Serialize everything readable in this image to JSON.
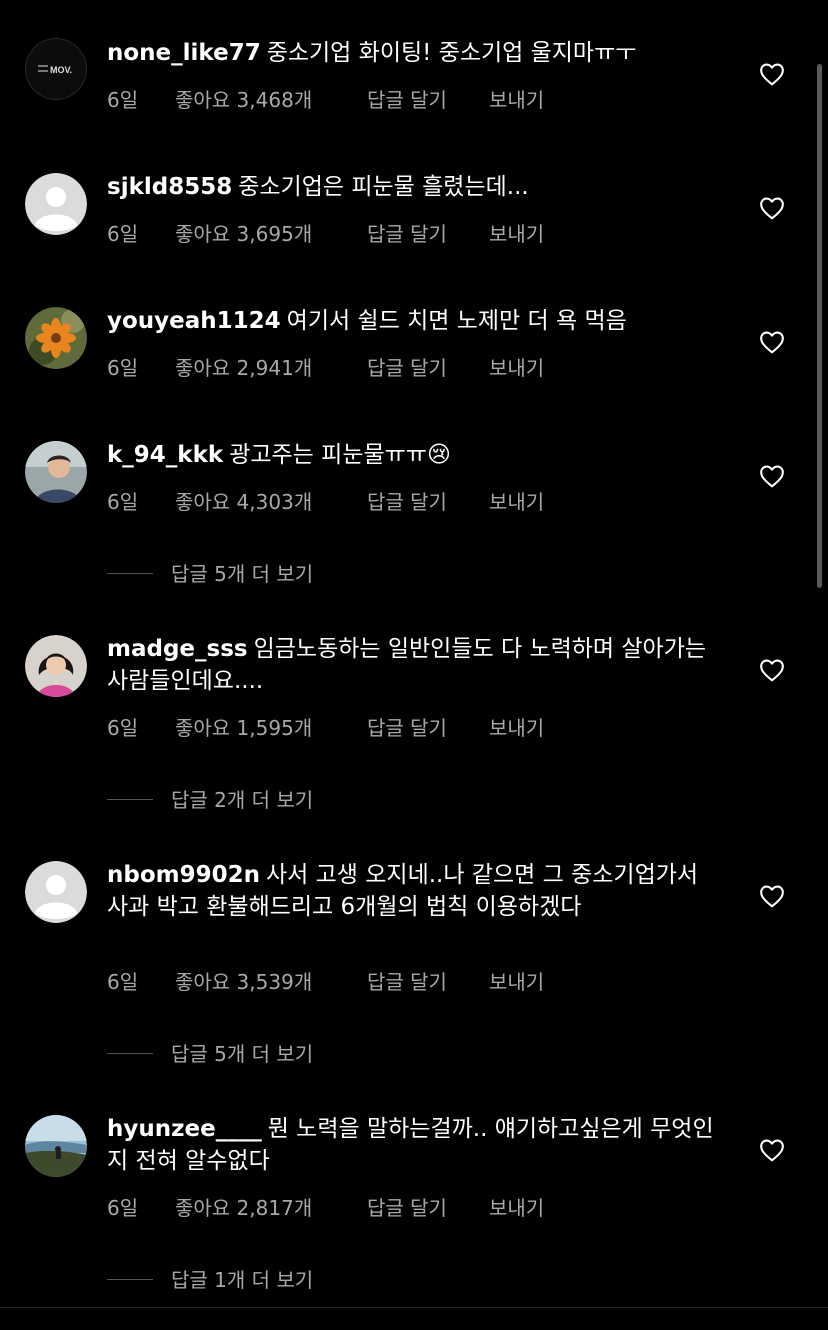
{
  "labels": {
    "reply": "답글 달기",
    "send": "보내기"
  },
  "comments": [
    {
      "username": "none_like77",
      "text": "중소기업 화이팅! 중소기업 울지마ㅠㅜ",
      "time": "6일",
      "likes": "좋아요 3,468개",
      "avatar_icon": "dark-logo-avatar",
      "avatar_text": "MOV."
    },
    {
      "username": "sjkld8558",
      "text": "중소기업은 피눈물 흘렸는데...",
      "time": "6일",
      "likes": "좋아요 3,695개",
      "avatar_icon": "default-avatar"
    },
    {
      "username": "youyeah1124",
      "text": "여기서 쉴드 치면 노제만 더 욕 먹음",
      "time": "6일",
      "likes": "좋아요 2,941개",
      "avatar_icon": "flower-photo-avatar"
    },
    {
      "username": "k_94_kkk",
      "text": "광고주는 피눈물ㅠㅠ😢",
      "time": "6일",
      "likes": "좋아요 4,303개",
      "avatar_icon": "person-photo-avatar",
      "view_replies": "답글 5개 더 보기"
    },
    {
      "username": "madge_sss",
      "text": "임금노동하는 일반인들도 다 노력하며 살아가는 사람들인데요....",
      "time": "6일",
      "likes": "좋아요 1,595개",
      "avatar_icon": "person-photo-avatar",
      "view_replies": "답글 2개 더 보기"
    },
    {
      "username": "nbom9902n",
      "text": "사서 고생 오지네..나 같으면 그 중소기업가서 사과 박고 환불해드리고 6개월의 법칙 이용하겠다",
      "time": "6일",
      "likes": "좋아요 3,539개",
      "avatar_icon": "default-avatar",
      "view_replies": "답글 5개 더 보기"
    },
    {
      "username": "hyunzee____",
      "text": "뭔 노력을 말하는걸까.. 얘기하고싶은게 무엇인지 전혀 알수없다",
      "time": "6일",
      "likes": "좋아요 2,817개",
      "avatar_icon": "landscape-photo-avatar",
      "view_replies": "답글 1개 더 보기"
    }
  ],
  "colors": {
    "background": "#000000",
    "text": "#ffffff",
    "secondary": "#a8a8a8",
    "divider": "#555555"
  }
}
